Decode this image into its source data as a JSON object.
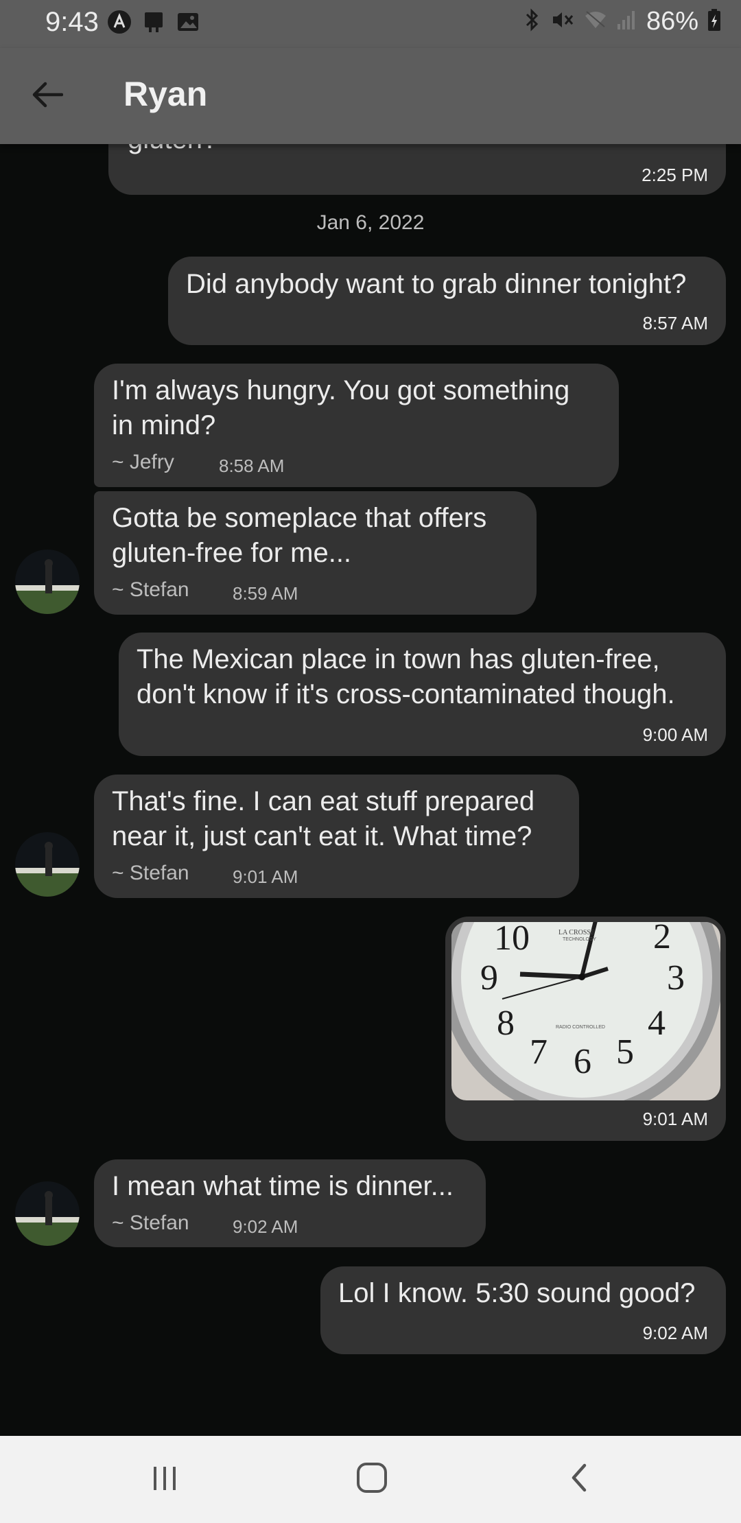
{
  "status_bar": {
    "time": "9:43",
    "battery": "86%",
    "left_icons": [
      "a-logo-icon",
      "notification-app-icon",
      "image-icon"
    ],
    "right_icons": [
      "bluetooth-icon",
      "mute-vibrate-icon",
      "wifi-off-icon",
      "signal-icon",
      "battery-charging-icon"
    ]
  },
  "header": {
    "title": "Ryan",
    "back_icon": "arrow-left-icon"
  },
  "date_separator": "Jan 6, 2022",
  "messages": [
    {
      "direction": "out",
      "time": "2:25 PM",
      "text_fragment": "gluten?"
    },
    {
      "direction": "out",
      "text": "Did anybody want to grab dinner tonight?",
      "time": "8:57 AM"
    },
    {
      "direction": "in",
      "lines": [
        "I'm always hungry. You got something",
        "in mind?"
      ],
      "sender": "~ Jefry",
      "time": "8:58 AM"
    },
    {
      "direction": "in",
      "lines": [
        "Gotta be someplace that offers",
        "gluten-free for me..."
      ],
      "sender": "~ Stefan",
      "time": "8:59 AM"
    },
    {
      "direction": "out",
      "lines": [
        "The Mexican place in town has gluten-free,",
        "don't know if it's cross-contaminated though."
      ],
      "time": "9:00 AM"
    },
    {
      "direction": "in",
      "lines": [
        "That's fine. I can eat stuff prepared",
        "near it, just can't eat it. What time?"
      ],
      "sender": "~ Stefan",
      "time": "9:01 AM"
    },
    {
      "direction": "out",
      "image": "clock-photo",
      "time": "9:01 AM"
    },
    {
      "direction": "in",
      "text": "I mean what time is dinner...",
      "sender": "~ Stefan",
      "time": "9:02 AM"
    },
    {
      "direction": "out",
      "text": "Lol I know. 5:30 sound good?",
      "time": "9:02 AM"
    }
  ],
  "clock_photo": {
    "numerals": [
      "10",
      "2",
      "9",
      "3",
      "8",
      "4",
      "7",
      "6",
      "5"
    ],
    "brand": "LA CROSSE",
    "brand_sub": "TECHNOLOGY",
    "bottom_text": "RADIO CONTROLLED"
  },
  "nav_bar": {
    "buttons": [
      "recents-icon",
      "home-icon",
      "back-icon"
    ]
  }
}
